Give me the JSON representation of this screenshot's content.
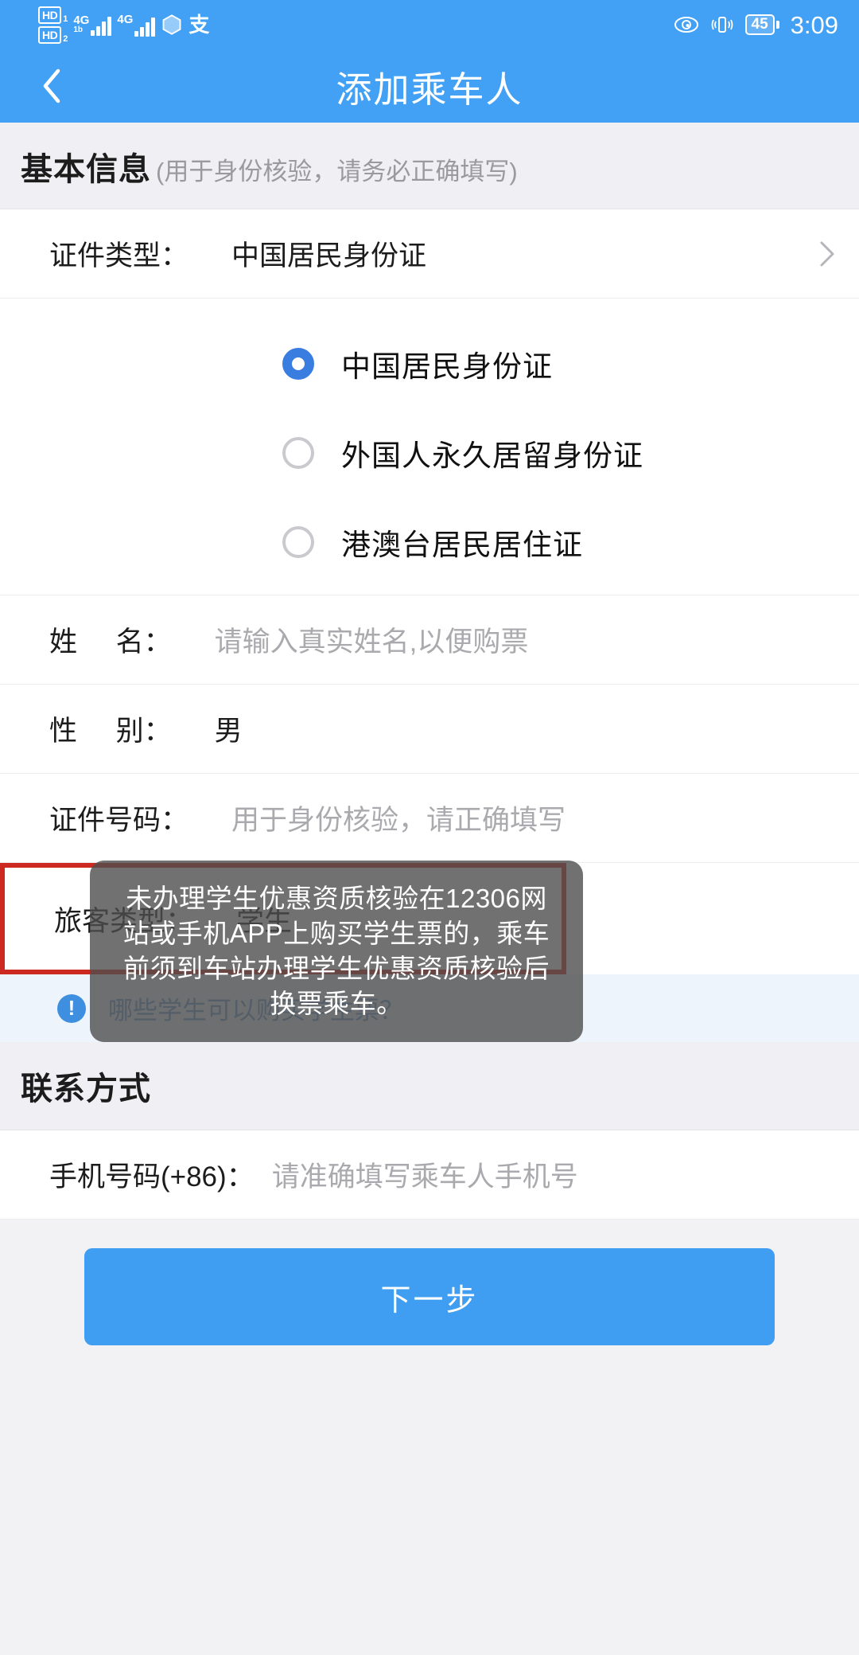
{
  "status_bar": {
    "hd1_label": "HD",
    "hd1_sub": "1",
    "hd2_label": "HD",
    "hd2_sub": "2",
    "sim1_network": "4G",
    "sim1_sub": "1b",
    "sim2_network": "4G",
    "alipay_glyph": "支",
    "battery_percent": "45",
    "time": "3:09",
    "icons": [
      "hd1-icon",
      "hd2-icon",
      "signal-bars-icon",
      "signal-bars-icon",
      "hexagon-icon",
      "alipay-icon",
      "eye-icon",
      "vibrate-icon",
      "battery-icon"
    ]
  },
  "appbar": {
    "back_icon": "chevron-left-icon",
    "title": "添加乘车人"
  },
  "basic_section": {
    "title": "基本信息",
    "hint": "(用于身份核验，请务必正确填写)"
  },
  "id_type_row": {
    "label": "证件类型：",
    "value": "中国居民身份证",
    "chevron": "chevron-right-icon"
  },
  "id_type_options": [
    {
      "label": "中国居民身份证",
      "selected": true
    },
    {
      "label": "外国人永久居留身份证",
      "selected": false
    },
    {
      "label": "港澳台居民居住证",
      "selected": false
    }
  ],
  "name_row": {
    "label": "姓     名：",
    "placeholder": "请输入真实姓名,以便购票"
  },
  "gender_row": {
    "label": "性     别：",
    "value": "男"
  },
  "id_number_row": {
    "label": "证件号码：",
    "placeholder": "用于身份核验，请正确填写"
  },
  "passenger_type_row": {
    "label": "旅客类型：",
    "value": "学生",
    "highlight_color": "#cc2a20"
  },
  "student_info_strip": {
    "icon": "info-icon",
    "text": "哪些学生可以购买学生票？",
    "link_color": "#6a9fd6"
  },
  "contact_section": {
    "title": "联系方式"
  },
  "phone_row": {
    "label": "手机号码(+86)：",
    "placeholder": "请准确填写乘车人手机号"
  },
  "toast": {
    "message": "未办理学生优惠资质核验在12306网站或手机APP上购买学生票的，乘车前须到车站办理学生优惠资质核验后换票乘车。"
  },
  "footer": {
    "next_label": "下一步",
    "accent_color": "#3f9ef2"
  }
}
